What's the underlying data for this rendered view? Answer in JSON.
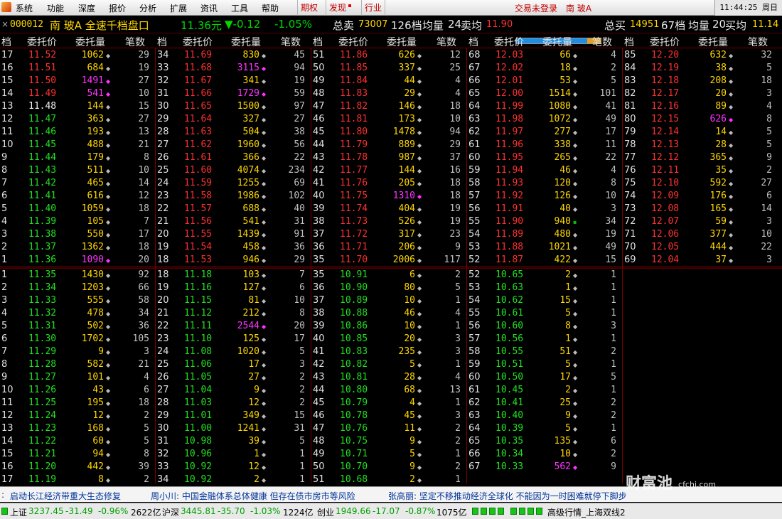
{
  "menu": {
    "items": [
      "系统",
      "功能",
      "深度",
      "报价",
      "分析",
      "扩展",
      "资讯",
      "工具",
      "帮助"
    ],
    "highlights": [
      {
        "label": "期权",
        "dot": false
      },
      {
        "label": "发现",
        "dot": true
      },
      {
        "label": "行业",
        "dot": false
      }
    ],
    "login_status": "交易未登录",
    "stock_short": "南 玻A",
    "clock": "11:44:25 周日"
  },
  "info": {
    "close": "×",
    "code": "000012",
    "name": "南 玻A 全速千档盘口",
    "price": "11.36元",
    "change": "▼-0.12",
    "pct": "-1.05%",
    "sell_total_label": "总卖",
    "sell_total": "73007",
    "sell_levels": "126档",
    "sell_avg_label": "均量",
    "sell_avg": "24",
    "sell_avgp_label": "卖均",
    "sell_avgp": "11.90",
    "vol_ratio": 0.16,
    "buy_total_label": "总买",
    "buy_total": "14951",
    "buy_levels": "67档",
    "buy_avg_label": "均量",
    "buy_avg": "20",
    "buy_avgp_label": "买均",
    "buy_avgp": "11.14"
  },
  "headers": {
    "level": "档",
    "price": "委托价",
    "qty": "委托量",
    "count": "笔数"
  },
  "sell_columns": [
    [
      [
        17,
        "11.52",
        1062,
        "w",
        29
      ],
      [
        16,
        "11.51",
        684,
        "w",
        19
      ],
      [
        15,
        "11.50",
        1491,
        "m",
        27
      ],
      [
        14,
        "11.49",
        541,
        "m",
        10
      ],
      [
        13,
        "11.48",
        144,
        "w",
        15
      ],
      [
        12,
        "11.47",
        363,
        "w",
        27
      ],
      [
        11,
        "11.46",
        193,
        "w",
        13
      ],
      [
        10,
        "11.45",
        488,
        "w",
        21
      ],
      [
        9,
        "11.44",
        179,
        "w",
        8
      ],
      [
        8,
        "11.43",
        511,
        "w",
        10
      ],
      [
        7,
        "11.42",
        465,
        "w",
        14
      ],
      [
        6,
        "11.41",
        616,
        "w",
        12
      ],
      [
        5,
        "11.40",
        1059,
        "w",
        18
      ],
      [
        4,
        "11.39",
        105,
        "w",
        7
      ],
      [
        3,
        "11.38",
        550,
        "w",
        17
      ],
      [
        2,
        "11.37",
        1362,
        "w",
        18
      ],
      [
        1,
        "11.36",
        1090,
        "m",
        20
      ]
    ],
    [
      [
        34,
        "11.69",
        830,
        "w",
        45
      ],
      [
        33,
        "11.68",
        3115,
        "m",
        94
      ],
      [
        32,
        "11.67",
        341,
        "w",
        19
      ],
      [
        31,
        "11.66",
        1729,
        "m",
        59
      ],
      [
        30,
        "11.65",
        1500,
        "w",
        97
      ],
      [
        29,
        "11.64",
        327,
        "w",
        27
      ],
      [
        28,
        "11.63",
        504,
        "w",
        38
      ],
      [
        27,
        "11.62",
        1960,
        "w",
        56
      ],
      [
        26,
        "11.61",
        366,
        "w",
        22
      ],
      [
        25,
        "11.60",
        4074,
        "w",
        234
      ],
      [
        24,
        "11.59",
        1255,
        "w",
        69
      ],
      [
        23,
        "11.58",
        1986,
        "w",
        102
      ],
      [
        22,
        "11.57",
        688,
        "w",
        40
      ],
      [
        21,
        "11.56",
        541,
        "w",
        31
      ],
      [
        20,
        "11.55",
        1439,
        "w",
        91
      ],
      [
        19,
        "11.54",
        458,
        "w",
        36
      ],
      [
        18,
        "11.53",
        946,
        "w",
        29
      ]
    ],
    [
      [
        51,
        "11.86",
        626,
        "w",
        12
      ],
      [
        50,
        "11.85",
        337,
        "w",
        25
      ],
      [
        49,
        "11.84",
        44,
        "w",
        4
      ],
      [
        48,
        "11.83",
        29,
        "w",
        4
      ],
      [
        47,
        "11.82",
        146,
        "w",
        18
      ],
      [
        46,
        "11.81",
        173,
        "w",
        10
      ],
      [
        45,
        "11.80",
        1478,
        "w",
        94
      ],
      [
        44,
        "11.79",
        889,
        "w",
        29
      ],
      [
        43,
        "11.78",
        987,
        "w",
        37
      ],
      [
        42,
        "11.77",
        144,
        "w",
        16
      ],
      [
        41,
        "11.76",
        205,
        "w",
        18
      ],
      [
        40,
        "11.75",
        1310,
        "m",
        18
      ],
      [
        39,
        "11.74",
        404,
        "w",
        19
      ],
      [
        38,
        "11.73",
        526,
        "w",
        19
      ],
      [
        37,
        "11.72",
        317,
        "w",
        23
      ],
      [
        36,
        "11.71",
        206,
        "w",
        9
      ],
      [
        35,
        "11.70",
        2006,
        "w",
        117
      ]
    ],
    [
      [
        68,
        "12.03",
        66,
        "w",
        4
      ],
      [
        67,
        "12.02",
        18,
        "w",
        2
      ],
      [
        66,
        "12.01",
        53,
        "w",
        5
      ],
      [
        65,
        "12.00",
        1514,
        "w",
        101
      ],
      [
        64,
        "11.99",
        1080,
        "w",
        41
      ],
      [
        63,
        "11.98",
        1072,
        "w",
        49
      ],
      [
        62,
        "11.97",
        277,
        "w",
        17
      ],
      [
        61,
        "11.96",
        338,
        "w",
        11
      ],
      [
        60,
        "11.95",
        265,
        "w",
        22
      ],
      [
        59,
        "11.94",
        46,
        "w",
        4
      ],
      [
        58,
        "11.93",
        120,
        "w",
        8
      ],
      [
        57,
        "11.92",
        126,
        "w",
        10
      ],
      [
        56,
        "11.91",
        40,
        "w",
        3
      ],
      [
        55,
        "11.90",
        940,
        "g",
        34
      ],
      [
        54,
        "11.89",
        480,
        "w",
        19
      ],
      [
        53,
        "11.88",
        1021,
        "w",
        49
      ],
      [
        52,
        "11.87",
        422,
        "w",
        15
      ]
    ],
    [
      [
        85,
        "12.20",
        632,
        "w",
        32
      ],
      [
        84,
        "12.19",
        38,
        "w",
        5
      ],
      [
        83,
        "12.18",
        208,
        "w",
        18
      ],
      [
        82,
        "12.17",
        20,
        "w",
        3
      ],
      [
        81,
        "12.16",
        89,
        "w",
        4
      ],
      [
        80,
        "12.15",
        626,
        "m",
        8
      ],
      [
        79,
        "12.14",
        14,
        "w",
        5
      ],
      [
        78,
        "12.13",
        28,
        "w",
        5
      ],
      [
        77,
        "12.12",
        365,
        "w",
        9
      ],
      [
        76,
        "12.11",
        35,
        "w",
        2
      ],
      [
        75,
        "12.10",
        592,
        "w",
        27
      ],
      [
        74,
        "12.09",
        176,
        "w",
        6
      ],
      [
        73,
        "12.08",
        165,
        "w",
        14
      ],
      [
        72,
        "12.07",
        59,
        "w",
        3
      ],
      [
        71,
        "12.06",
        377,
        "w",
        10
      ],
      [
        70,
        "12.05",
        444,
        "w",
        22
      ],
      [
        69,
        "12.04",
        37,
        "w",
        3
      ]
    ]
  ],
  "buy_columns": [
    [
      [
        1,
        "11.35",
        1430,
        "w",
        92
      ],
      [
        2,
        "11.34",
        1203,
        "w",
        66
      ],
      [
        3,
        "11.33",
        555,
        "w",
        58
      ],
      [
        4,
        "11.32",
        478,
        "w",
        34
      ],
      [
        5,
        "11.31",
        502,
        "w",
        36
      ],
      [
        6,
        "11.30",
        1702,
        "w",
        105
      ],
      [
        7,
        "11.29",
        9,
        "w",
        3
      ],
      [
        8,
        "11.28",
        582,
        "w",
        21
      ],
      [
        9,
        "11.27",
        101,
        "w",
        4
      ],
      [
        10,
        "11.26",
        43,
        "w",
        6
      ],
      [
        11,
        "11.25",
        195,
        "w",
        18
      ],
      [
        12,
        "11.24",
        12,
        "w",
        2
      ],
      [
        13,
        "11.23",
        168,
        "w",
        5
      ],
      [
        14,
        "11.22",
        60,
        "w",
        5
      ],
      [
        15,
        "11.21",
        94,
        "w",
        8
      ],
      [
        16,
        "11.20",
        442,
        "w",
        39
      ],
      [
        17,
        "11.19",
        8,
        "w",
        2
      ]
    ],
    [
      [
        18,
        "11.18",
        103,
        "w",
        7
      ],
      [
        19,
        "11.16",
        127,
        "w",
        6
      ],
      [
        20,
        "11.15",
        81,
        "w",
        10
      ],
      [
        21,
        "11.12",
        212,
        "w",
        8
      ],
      [
        22,
        "11.11",
        2544,
        "m",
        20
      ],
      [
        23,
        "11.10",
        125,
        "w",
        17
      ],
      [
        24,
        "11.08",
        1020,
        "w",
        5
      ],
      [
        25,
        "11.06",
        17,
        "w",
        3
      ],
      [
        26,
        "11.05",
        27,
        "w",
        2
      ],
      [
        27,
        "11.04",
        9,
        "w",
        2
      ],
      [
        28,
        "11.03",
        12,
        "w",
        2
      ],
      [
        29,
        "11.01",
        349,
        "w",
        15
      ],
      [
        30,
        "11.00",
        1241,
        "w",
        31
      ],
      [
        31,
        "10.98",
        39,
        "w",
        5
      ],
      [
        32,
        "10.96",
        1,
        "w",
        1
      ],
      [
        33,
        "10.92",
        12,
        "w",
        1
      ],
      [
        34,
        "10.92",
        2,
        "w",
        1
      ]
    ],
    [
      [
        35,
        "10.91",
        6,
        "w",
        2
      ],
      [
        36,
        "10.90",
        80,
        "w",
        5
      ],
      [
        37,
        "10.89",
        10,
        "w",
        1
      ],
      [
        38,
        "10.88",
        46,
        "w",
        4
      ],
      [
        39,
        "10.86",
        10,
        "w",
        1
      ],
      [
        40,
        "10.85",
        20,
        "w",
        3
      ],
      [
        41,
        "10.83",
        235,
        "w",
        3
      ],
      [
        42,
        "10.82",
        5,
        "w",
        1
      ],
      [
        43,
        "10.81",
        28,
        "w",
        4
      ],
      [
        44,
        "10.80",
        68,
        "w",
        13
      ],
      [
        45,
        "10.79",
        4,
        "w",
        1
      ],
      [
        46,
        "10.78",
        45,
        "w",
        3
      ],
      [
        47,
        "10.76",
        11,
        "w",
        2
      ],
      [
        48,
        "10.75",
        9,
        "w",
        2
      ],
      [
        49,
        "10.71",
        5,
        "w",
        1
      ],
      [
        50,
        "10.70",
        9,
        "w",
        2
      ],
      [
        51,
        "10.68",
        2,
        "w",
        1
      ]
    ],
    [
      [
        52,
        "10.65",
        2,
        "w",
        1
      ],
      [
        53,
        "10.63",
        1,
        "w",
        1
      ],
      [
        54,
        "10.62",
        15,
        "w",
        1
      ],
      [
        55,
        "10.61",
        5,
        "w",
        1
      ],
      [
        56,
        "10.60",
        8,
        "w",
        3
      ],
      [
        57,
        "10.56",
        1,
        "w",
        1
      ],
      [
        58,
        "10.55",
        51,
        "w",
        2
      ],
      [
        59,
        "10.51",
        5,
        "w",
        1
      ],
      [
        60,
        "10.50",
        17,
        "w",
        5
      ],
      [
        61,
        "10.45",
        2,
        "w",
        1
      ],
      [
        62,
        "10.41",
        25,
        "w",
        2
      ],
      [
        63,
        "10.40",
        9,
        "w",
        2
      ],
      [
        64,
        "10.39",
        5,
        "w",
        1
      ],
      [
        65,
        "10.35",
        135,
        "w",
        6
      ],
      [
        66,
        "10.34",
        10,
        "w",
        2
      ],
      [
        67,
        "10.33",
        562,
        "m",
        9
      ]
    ],
    []
  ],
  "marks": {
    "w": "◆",
    "m": "◆",
    "g": "▪"
  },
  "news": {
    "items": [
      "启动长江经济带重大生态修复",
      "周小川: 中国金融体系总体健康 但存在债市房市等风险",
      "张高丽: 坚定不移推动经济全球化 不能因为一时困难就停下脚步"
    ]
  },
  "watermark": {
    "big": "财富池",
    "small": "cfchi.com"
  },
  "status": {
    "sh_label": "上证",
    "sh_val": "3237.45",
    "sh_chg": "-31.49",
    "sh_pct": "-0.96%",
    "sh_amt": "2622亿",
    "sz_label": "沪深",
    "sz_val": "3445.81",
    "sz_chg": "-35.70",
    "sz_pct": "-1.03%",
    "sz_amt": "1224亿",
    "cy_label": "创业",
    "cy_val": "1949.66",
    "cy_chg": "-17.07",
    "cy_pct": "-0.87%",
    "cy_amt": "1075亿",
    "right_label": "高级行情_上海双线2"
  }
}
